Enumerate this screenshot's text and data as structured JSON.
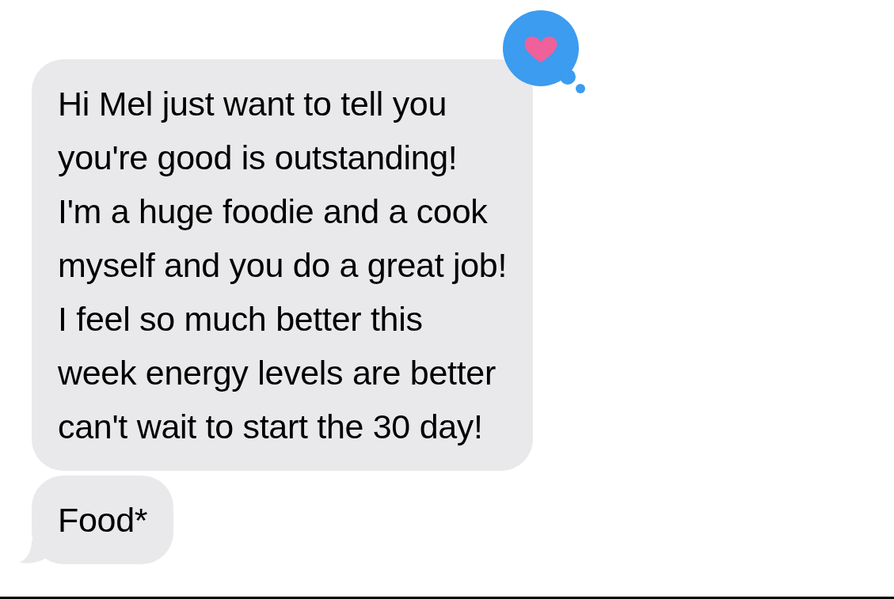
{
  "messages": [
    {
      "lines": [
        "Hi Mel just want to tell you",
        "you're good is outstanding!",
        "I'm a huge foodie and a cook",
        "myself and you do a great job!",
        "I feel so much better this",
        "week energy levels are better",
        "can't wait to start the 30 day!"
      ],
      "heart_reaction": true,
      "tail": false
    },
    {
      "lines": [
        "Food*"
      ],
      "tail": true
    }
  ]
}
